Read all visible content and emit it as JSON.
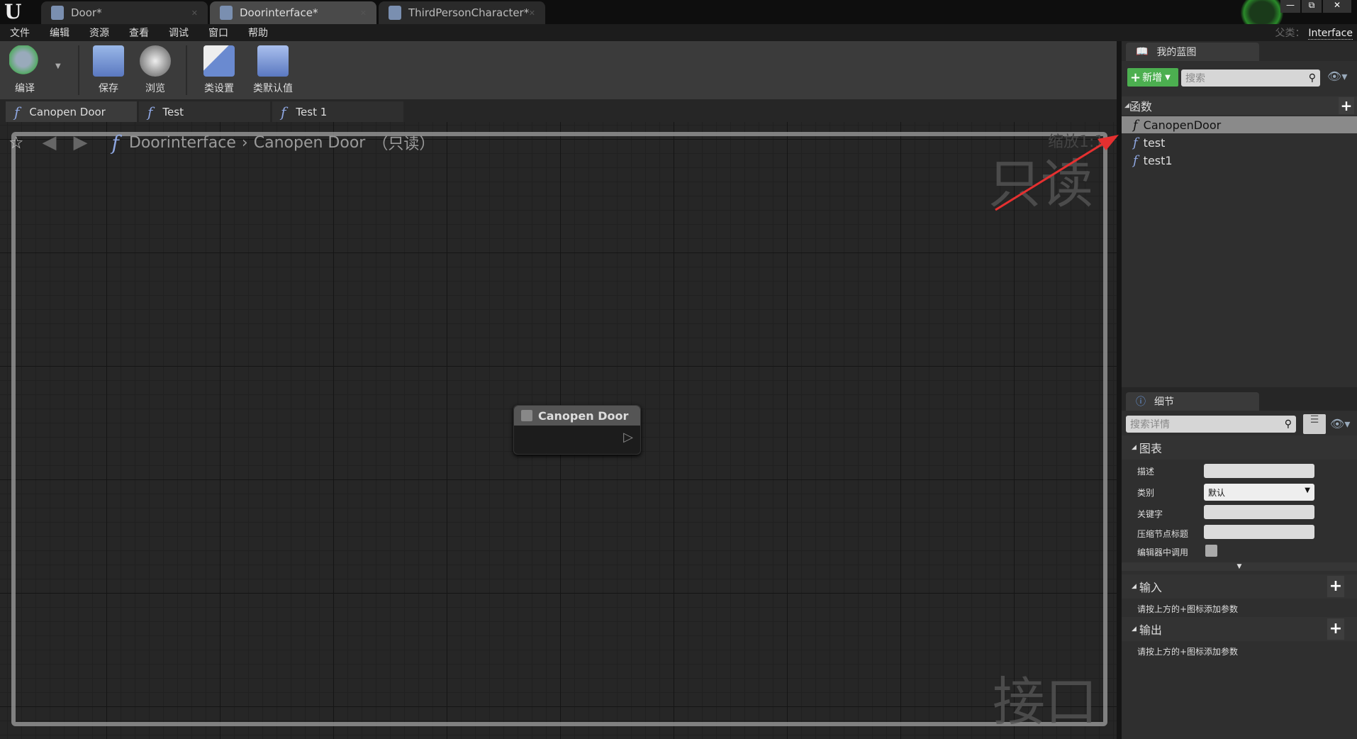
{
  "app": {
    "logo": "U"
  },
  "doc_tabs": [
    {
      "label": "Door*"
    },
    {
      "label": "Doorinterface*"
    },
    {
      "label": "ThirdPersonCharacter*"
    }
  ],
  "window_controls": {
    "minimize": "—",
    "restore": "⧉",
    "close": "✕"
  },
  "parent_class": {
    "label": "父类：",
    "value": "Interface"
  },
  "menu": [
    "文件",
    "编辑",
    "资源",
    "查看",
    "调试",
    "窗口",
    "帮助"
  ],
  "toolbar": {
    "compile": "编译",
    "save": "保存",
    "browse": "浏览",
    "class_settings": "类设置",
    "class_defaults": "类默认值"
  },
  "graph_tabs": [
    {
      "label": "Canopen Door"
    },
    {
      "label": "Test"
    },
    {
      "label": "Test 1"
    }
  ],
  "breadcrumb": {
    "root": "Doorinterface",
    "sep": "›",
    "current": "Canopen Door",
    "suffix": "（只读）"
  },
  "watermarks": {
    "readonly": "只读",
    "zoom": "缩放1:1",
    "interface": "接口"
  },
  "node": {
    "title": "Canopen Door"
  },
  "my_blueprint": {
    "tab": "我的蓝图",
    "add_label": "新增",
    "search_placeholder": "搜索",
    "section": "函数",
    "functions": [
      "CanopenDoor",
      "test",
      "test1"
    ]
  },
  "details": {
    "tab": "细节",
    "search_placeholder": "搜索详情",
    "section": "图表",
    "fields": {
      "description": "描述",
      "category": "类别",
      "category_value": "默认",
      "keywords": "关键字",
      "compact_title": "压缩节点标题",
      "call_in_editor": "编辑器中调用"
    },
    "inputs": "输入",
    "outputs": "输出",
    "hint": "请按上方的+图标添加参数"
  },
  "colors": {
    "accent_green": "#4caf50",
    "arrow": "#e53030",
    "selected": "#8a8a8a"
  }
}
